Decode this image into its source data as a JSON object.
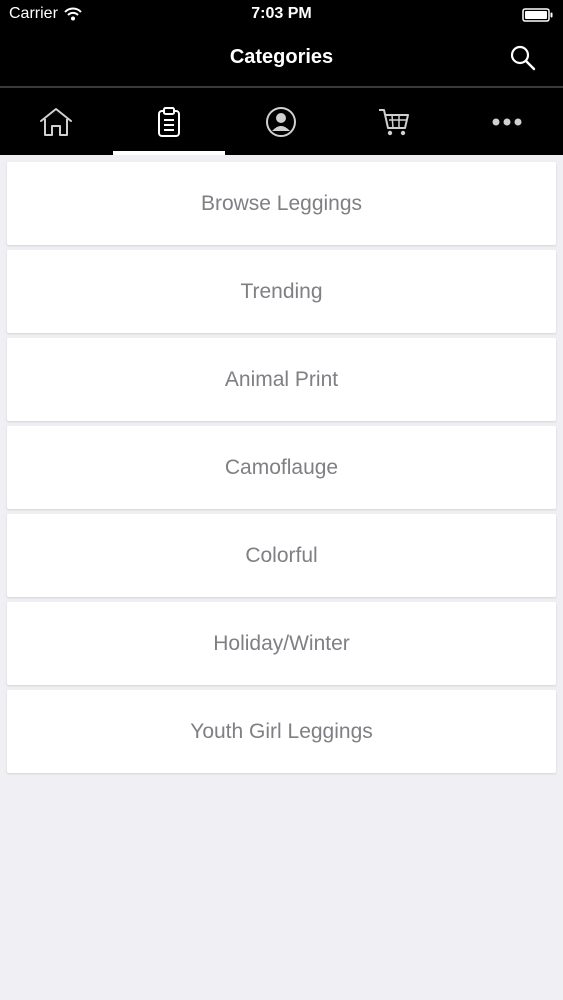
{
  "status_bar": {
    "carrier": "Carrier",
    "time": "7:03 PM"
  },
  "nav": {
    "title": "Categories",
    "search_icon": "search-icon"
  },
  "tabs": [
    {
      "icon": "home-icon",
      "active": false
    },
    {
      "icon": "clipboard-icon",
      "active": true
    },
    {
      "icon": "account-icon",
      "active": false
    },
    {
      "icon": "cart-icon",
      "active": false
    },
    {
      "icon": "more-icon",
      "active": false
    }
  ],
  "categories": [
    {
      "label": "Browse Leggings"
    },
    {
      "label": "Trending"
    },
    {
      "label": "Animal Print"
    },
    {
      "label": "Camoflauge"
    },
    {
      "label": "Colorful"
    },
    {
      "label": "Holiday/Winter"
    },
    {
      "label": "Youth Girl Leggings"
    }
  ],
  "colors": {
    "bar_background": "#000000",
    "page_background": "#efeff4",
    "item_text": "#7f7f84",
    "tab_icon": "#d0d0d0"
  }
}
